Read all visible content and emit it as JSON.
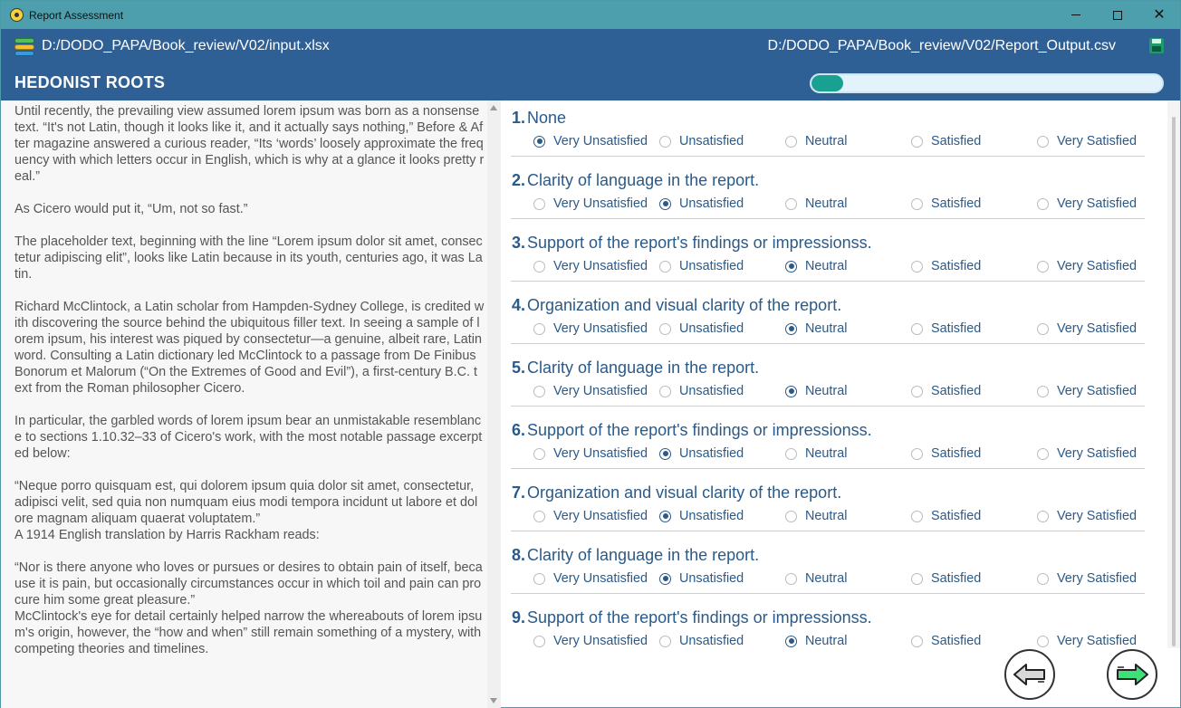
{
  "window": {
    "title": "Report Assessment"
  },
  "header": {
    "input_path": "D:/DODO_PAPA/Book_review/V02/input.xlsx",
    "output_path": "D:/DODO_PAPA/Book_review/V02/Report_Output.csv",
    "book_title": "HEDONIST ROOTS",
    "progress": 0.09
  },
  "article": {
    "paragraphs": [
      "Until recently, the prevailing view assumed lorem ipsum was born as a nonsense text. “It's not Latin, though it looks like it, and it actually says nothing,” Before & After magazine answered a curious reader, “Its ‘words’ loosely approximate the frequency with which letters occur in English, which is why at a glance it looks pretty real.”",
      "As Cicero would put it, “Um, not so fast.”",
      "The placeholder text, beginning with the line “Lorem ipsum dolor sit amet, consectetur adipiscing elit”, looks like Latin because in its youth, centuries ago, it was Latin.",
      "Richard McClintock, a Latin scholar from Hampden-Sydney College, is credited with discovering the source behind the ubiquitous filler text. In seeing a sample of lorem ipsum, his interest was piqued by consectetur—a genuine, albeit rare, Latin word. Consulting a Latin dictionary led McClintock to a passage from De Finibus Bonorum et Malorum (“On the Extremes of Good and Evil”), a first-century B.C. text from the Roman philosopher Cicero.",
      "In particular, the garbled words of lorem ipsum bear an unmistakable resemblance to sections 1.10.32–33 of Cicero's work, with the most notable passage excerpted below:",
      "“Neque porro quisquam est, qui dolorem ipsum quia dolor sit amet, consectetur, adipisci velit, sed quia non numquam eius modi tempora incidunt ut labore et dolore magnam aliquam quaerat voluptatem.”",
      "A 1914 English translation by Harris Rackham reads:",
      "“Nor is there anyone who loves or pursues or desires to obtain pain of itself, because it is pain, but occasionally circumstances occur in which toil and pain can procure him some great pleasure.”",
      "McClintock's eye for detail certainly helped narrow the whereabouts of lorem ipsum's origin, however, the “how and when” still remain something of a mystery, with competing theories and timelines."
    ]
  },
  "options": [
    "Very Unsatisfied",
    "Unsatisfied",
    "Neutral",
    "Satisfied",
    "Very Satisfied"
  ],
  "questions": [
    {
      "num": "1.",
      "text": "None",
      "selected": 0
    },
    {
      "num": "2.",
      "text": "Clarity of language in the report.",
      "selected": 1
    },
    {
      "num": "3.",
      "text": "Support of the report's findings or impressionss.",
      "selected": 2
    },
    {
      "num": "4.",
      "text": "Organization and visual clarity of the report.",
      "selected": 2
    },
    {
      "num": "5.",
      "text": "Clarity of language in the report.",
      "selected": 2
    },
    {
      "num": "6.",
      "text": "Support of the report's findings or impressionss.",
      "selected": 1
    },
    {
      "num": "7.",
      "text": "Organization and visual clarity of the report.",
      "selected": 1
    },
    {
      "num": "8.",
      "text": "Clarity of language in the report.",
      "selected": 1
    },
    {
      "num": "9.",
      "text": "Support of the report's findings or impressionss.",
      "selected": 2
    }
  ],
  "icons": {
    "app": "radiation-icon",
    "input": "database-icon",
    "save": "save-icon",
    "prev": "arrow-left-icon",
    "next": "arrow-right-icon"
  },
  "colors": {
    "titlebar": "#4d9fae",
    "header": "#2e6096",
    "progress_fill": "#18a090",
    "question_text": "#2a5a8a"
  }
}
